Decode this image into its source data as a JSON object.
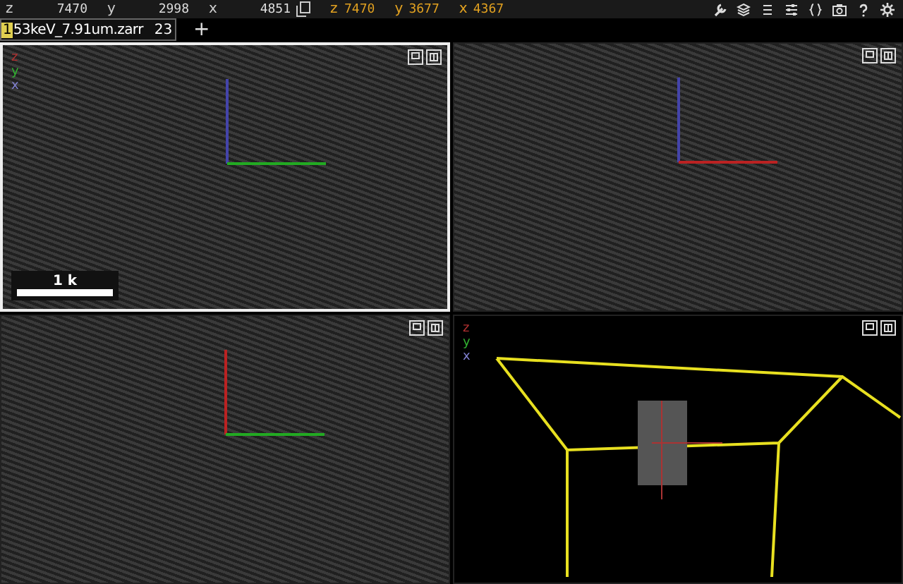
{
  "position_bar": {
    "coordinates": [
      {
        "axis": "z",
        "value": "7470"
      },
      {
        "axis": "y",
        "value": "2998"
      },
      {
        "axis": "x",
        "value": "4851"
      }
    ],
    "mouse_coordinates": [
      {
        "axis": "z",
        "value": "7470"
      },
      {
        "axis": "y",
        "value": "3677"
      },
      {
        "axis": "x",
        "value": "4367"
      }
    ]
  },
  "layer_bar": {
    "layers": [
      {
        "index": "1",
        "name": "53keV_7.91um.zarr",
        "value": "23"
      }
    ],
    "add_button": "+"
  },
  "panels": [
    {
      "kind": "xy",
      "selected": true,
      "axis_labels": [
        {
          "text": "z",
          "color": "#b03030"
        },
        {
          "text": "y",
          "color": "#30b030"
        },
        {
          "text": "x",
          "color": "#8080d0"
        }
      ],
      "scale_bar": "1 k"
    },
    {
      "kind": "xz",
      "selected": false
    },
    {
      "kind": "yz",
      "selected": false
    },
    {
      "kind": "volume",
      "selected": false,
      "axis_labels": [
        {
          "text": "z",
          "color": "#b03030"
        },
        {
          "text": "y",
          "color": "#30b030"
        },
        {
          "text": "x",
          "color": "#8080d0"
        }
      ]
    }
  ]
}
